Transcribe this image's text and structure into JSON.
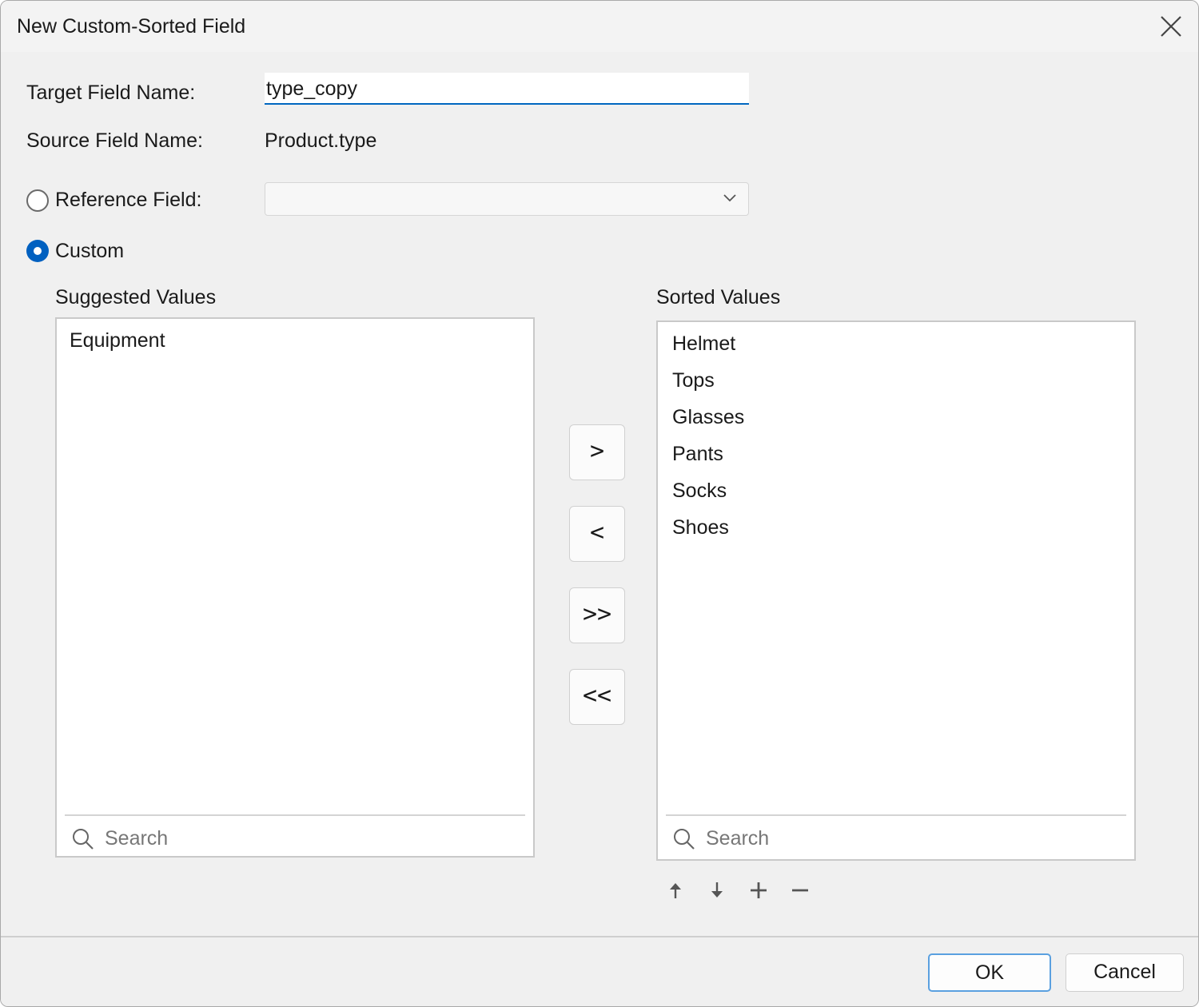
{
  "dialog": {
    "title": "New Custom-Sorted Field"
  },
  "form": {
    "target_label": "Target Field Name:",
    "target_value": "type_copy",
    "source_label": "Source Field Name:",
    "source_value": "Product.type",
    "reference_label": "Reference Field:",
    "reference_selected": false,
    "reference_value": "",
    "custom_label": "Custom",
    "custom_selected": true
  },
  "suggested": {
    "title": "Suggested Values",
    "items": [
      "Equipment"
    ],
    "search_placeholder": "Search"
  },
  "sorted": {
    "title": "Sorted Values",
    "items": [
      "Helmet",
      "Tops",
      "Glasses",
      "Pants",
      "Socks",
      "Shoes"
    ],
    "search_placeholder": "Search"
  },
  "move_buttons": {
    "add": ">",
    "remove": "<",
    "add_all": ">>",
    "remove_all": "<<"
  },
  "icons": {
    "close": "close-icon",
    "chevron": "chevron-down-icon",
    "search": "search-icon",
    "move_up": "arrow-up-icon",
    "move_down": "arrow-down-icon",
    "add": "plus-icon",
    "remove": "minus-icon"
  },
  "footer": {
    "ok_label": "OK",
    "cancel_label": "Cancel"
  },
  "colors": {
    "accent": "#0060c0",
    "focus_border": "#5aa0e0"
  }
}
